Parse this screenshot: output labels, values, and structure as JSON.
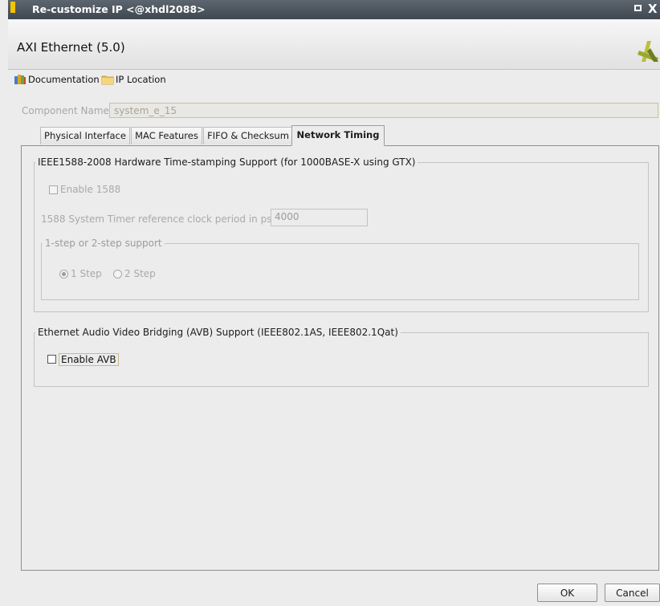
{
  "window": {
    "title": "Re-customize IP <@xhdl2088>",
    "title_icon": "vivado-icon",
    "controls": [
      "maximize-icon",
      "close-icon"
    ],
    "close_glyph": "X"
  },
  "header": {
    "ip_name": "AXI Ethernet (5.0)",
    "logo_icon": "xilinx-logo-icon"
  },
  "toolbar": {
    "documentation_label": "Documentation",
    "ip_location_label": "IP Location"
  },
  "component": {
    "label": "Component Name",
    "value": "system_e_15"
  },
  "tabs": [
    {
      "label": "Physical Interface",
      "active": false
    },
    {
      "label": "MAC Features",
      "active": false
    },
    {
      "label": "FIFO & Checksum",
      "active": false
    },
    {
      "label": "Network Timing",
      "active": true
    }
  ],
  "timestamping": {
    "legend": "IEEE1588-2008 Hardware Time-stamping Support (for 1000BASE-X using GTX)",
    "enable_label": "Enable 1588",
    "enable_checked": false,
    "timer_label": "1588 System Timer reference clock period in ps",
    "timer_value": "4000",
    "step_legend": "1-step or 2-step support",
    "step_options": [
      {
        "label": "1 Step",
        "selected": true
      },
      {
        "label": "2 Step",
        "selected": false
      }
    ]
  },
  "avb": {
    "legend": "Ethernet Audio Video Bridging (AVB) Support (IEEE802.1AS, IEEE802.1Qat)",
    "enable_label": "Enable AVB",
    "enable_checked": false
  },
  "buttons": {
    "ok": "OK",
    "cancel": "Cancel"
  },
  "colors": {
    "titlebar": "#4b535b",
    "window_bg": "#ececec",
    "disabled_text": "#a9a9a9"
  }
}
